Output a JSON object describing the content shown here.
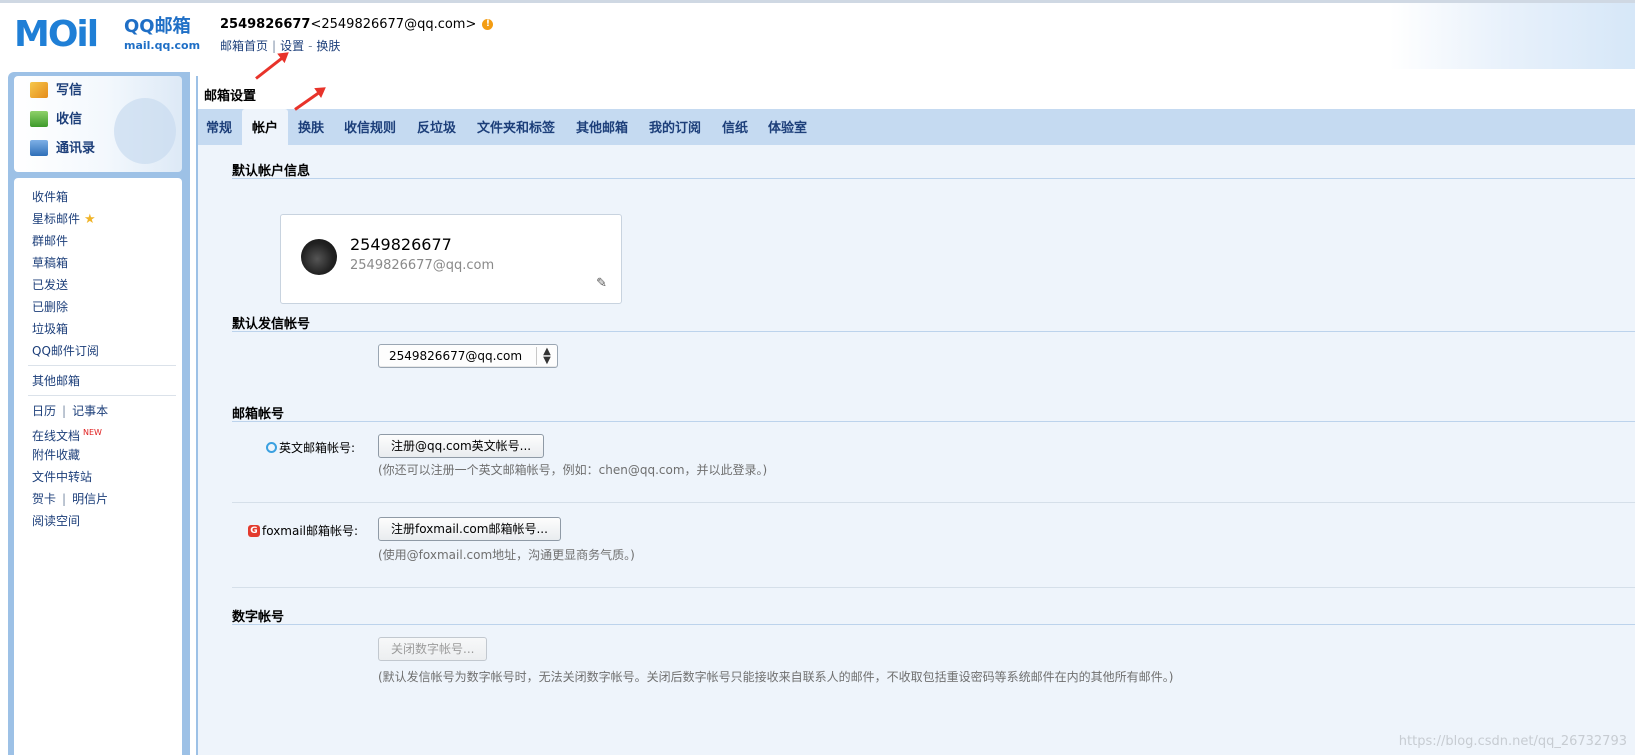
{
  "header": {
    "logo_text": "MOil",
    "logo_brand": "QQ邮箱",
    "logo_domain": "mail.qq.com",
    "account_id": "2549826677",
    "account_email": "<2549826677@qq.com>",
    "links": [
      "邮箱首页",
      "设置",
      "换肤"
    ]
  },
  "quick_actions": [
    {
      "label": "写信",
      "icon": "compose-icon"
    },
    {
      "label": "收信",
      "icon": "inbox-download-icon"
    },
    {
      "label": "通讯录",
      "icon": "contacts-icon"
    }
  ],
  "sidebar": {
    "folders": [
      "收件箱",
      "星标邮件",
      "群邮件",
      "草稿箱",
      "已发送",
      "已删除",
      "垃圾箱",
      "QQ邮件订阅"
    ],
    "other_mailbox": "其他邮箱",
    "tools": {
      "calendar": "日历",
      "notes": "记事本",
      "online_docs": "在线文档",
      "new_badge": "NEW",
      "attachments": "附件收藏",
      "transfer": "文件中转站",
      "cards": "贺卡",
      "postcards": "明信片",
      "reading": "阅读空间"
    }
  },
  "main": {
    "title": "邮箱设置",
    "tabs": [
      "常规",
      "帐户",
      "换肤",
      "收信规则",
      "反垃圾",
      "文件夹和标签",
      "其他邮箱",
      "我的订阅",
      "信纸",
      "体验室"
    ],
    "active_tab": "帐户",
    "sections": {
      "default_account": "默认帐户信息",
      "default_sender": "默认发信帐号",
      "mailbox_accounts": "邮箱帐号",
      "digit_account": "数字帐号"
    },
    "card": {
      "name": "2549826677",
      "email": "2549826677@qq.com"
    },
    "sender_select": {
      "value": "2549826677@qq.com"
    },
    "english_account": {
      "label": "英文邮箱帐号:",
      "button": "注册@qq.com英文帐号...",
      "hint": "(你还可以注册一个英文邮箱帐号，例如：chen@qq.com，并以此登录。)"
    },
    "foxmail_account": {
      "label": "foxmail邮箱帐号:",
      "button": "注册foxmail.com邮箱帐号...",
      "hint": "(使用@foxmail.com地址，沟通更显商务气质。)"
    },
    "digit": {
      "button": "关闭数字帐号...",
      "hint": "(默认发信帐号为数字帐号时，无法关闭数字帐号。关闭后数字帐号只能接收来自联系人的邮件，不收取包括重设密码等系统邮件在内的其他所有邮件。)"
    }
  },
  "watermark": "https://blog.csdn.net/qq_26732793",
  "colors": {
    "accent_blue": "#1d3f7a",
    "frame_blue": "#9dc1e6",
    "tab_bar": "#c5daf1",
    "panel_bg": "#eef4fb",
    "annotation_red": "#e8332a"
  }
}
